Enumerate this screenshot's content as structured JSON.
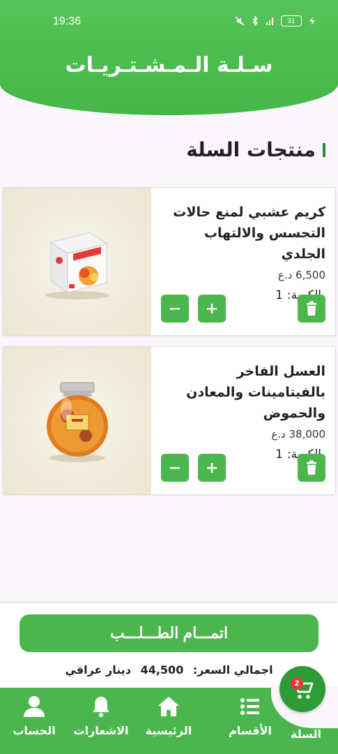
{
  "status_bar": {
    "time": "19:36",
    "battery": "31"
  },
  "header": {
    "title": "سـلـة الـمـشـتـريـات"
  },
  "section": {
    "title": "منتجات السلة"
  },
  "products": [
    {
      "name": "كريم عشبي لمنع حالات التحسس والالتهاب الجلدي",
      "price": "6,500 د.ع",
      "qty_label": "الكمية:",
      "qty": "1",
      "image_icon": "cream-box-image"
    },
    {
      "name": "العسل الفاخر بالفيتامينات والمعادن والحموض",
      "price": "38,000 د.ع",
      "qty_label": "الكمية:",
      "qty": "1",
      "image_icon": "honey-jar-image"
    }
  ],
  "summary": {
    "checkout_label": "اتمـــام الطـــلـــب",
    "total_label": "اجمالي السعر:",
    "total_value": "44,500",
    "currency": "دينار عراقي"
  },
  "nav": {
    "cart": "السلة",
    "categories": "الأقسام",
    "home": "الرئيسية",
    "notifications": "الاشعارات",
    "account": "الحساب",
    "cart_badge": "2"
  },
  "colors": {
    "primary": "#4cb64e",
    "primary_dark": "#2e9a38",
    "badge": "#e53935"
  }
}
